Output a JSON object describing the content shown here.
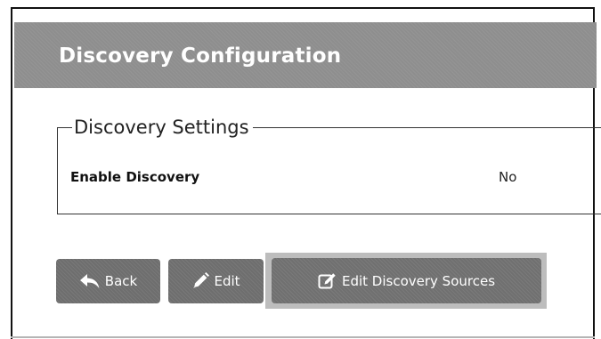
{
  "header": {
    "title": "Discovery Configuration"
  },
  "settings_group": {
    "legend": "Discovery Settings",
    "rows": [
      {
        "label": "Enable Discovery",
        "value": "No"
      }
    ]
  },
  "actions": {
    "back_label": "Back",
    "edit_label": "Edit",
    "edit_sources_label": "Edit Discovery Sources",
    "back_icon": "reply-arrow-icon",
    "edit_icon": "pencil-icon",
    "edit_sources_icon": "edit-square-icon"
  },
  "colors": {
    "header_bg": "#8e8e8e",
    "button_bg": "#6e6e6e",
    "text_on_dark": "#ffffff"
  }
}
